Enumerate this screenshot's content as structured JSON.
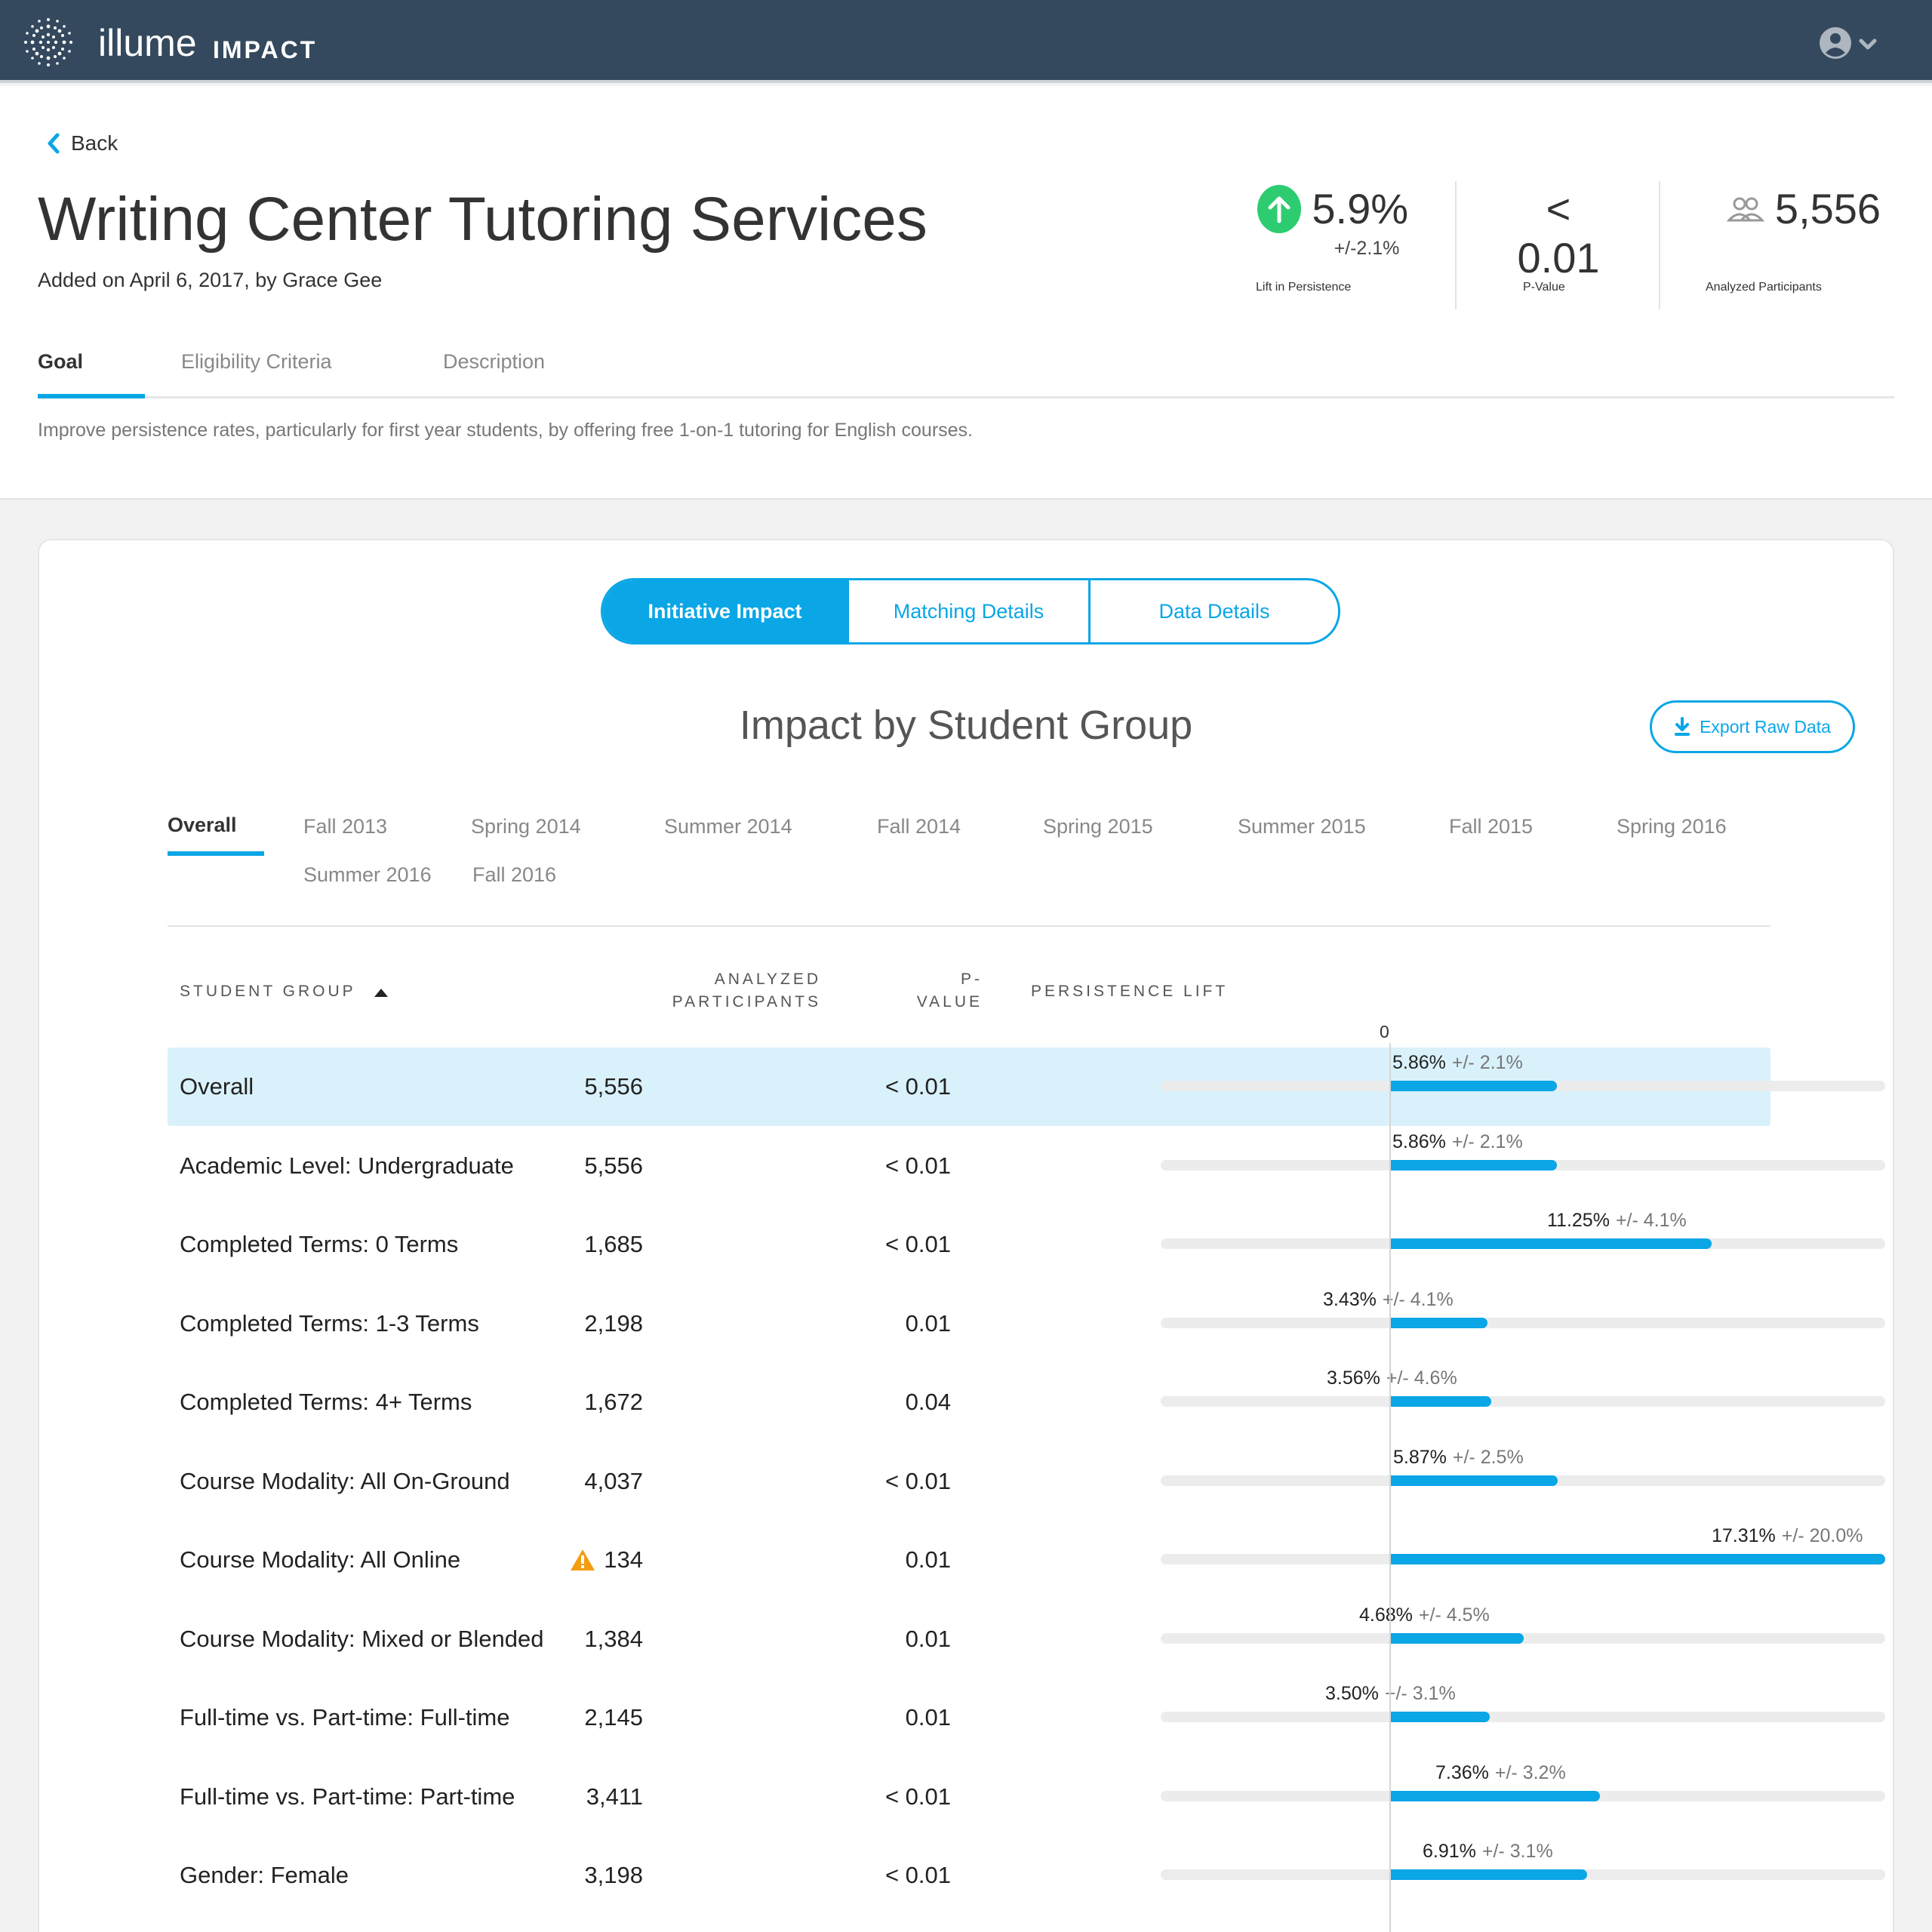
{
  "app": {
    "brand": "illume",
    "product": "IMPACT"
  },
  "nav": {
    "back_label": "Back"
  },
  "initiative": {
    "title": "Writing Center Tutoring Services",
    "added": "Added on April 6, 2017, by Grace Gee",
    "goal": "Improve persistence rates, particularly for first year students, by offering free 1-on-1 tutoring for English courses."
  },
  "stats": {
    "lift": {
      "value": "5.9%",
      "moe": "+/-2.1%",
      "label": "Lift in Persistence"
    },
    "pvalue": {
      "value": "< 0.01",
      "label": "P-Value"
    },
    "participants": {
      "value": "5,556",
      "label": "Analyzed Participants"
    }
  },
  "info_tabs": [
    "Goal",
    "Eligibility Criteria",
    "Description"
  ],
  "view_tabs": [
    "Initiative Impact",
    "Matching Details",
    "Data Details"
  ],
  "section": {
    "title": "Impact by Student Group",
    "export_label": "Export Raw Data"
  },
  "terms": [
    "Overall",
    "Fall 2013",
    "Spring 2014",
    "Summer 2014",
    "Fall 2014",
    "Spring 2015",
    "Summer 2015",
    "Fall 2015",
    "Spring 2016",
    "Summer 2016",
    "Fall 2016"
  ],
  "table": {
    "headers": {
      "group": "STUDENT GROUP",
      "analyzed_1": "ANALYZED",
      "analyzed_2": "PARTICIPANTS",
      "p_1": "P-",
      "p_2": "VALUE",
      "lift": "PERSISTENCE LIFT"
    },
    "zero_label": "0",
    "lift_max_pct": 17.31,
    "rows": [
      {
        "group": "Overall",
        "n": "5,556",
        "p": "< 0.01",
        "lift": 5.86,
        "lift_text": "5.86%",
        "moe": "+/- 2.1%",
        "warning": false
      },
      {
        "group": "Academic Level: Undergraduate",
        "n": "5,556",
        "p": "< 0.01",
        "lift": 5.86,
        "lift_text": "5.86%",
        "moe": "+/- 2.1%",
        "warning": false
      },
      {
        "group": "Completed Terms: 0 Terms",
        "n": "1,685",
        "p": "< 0.01",
        "lift": 11.25,
        "lift_text": "11.25%",
        "moe": "+/- 4.1%",
        "warning": false
      },
      {
        "group": "Completed Terms: 1-3 Terms",
        "n": "2,198",
        "p": "0.01",
        "lift": 3.43,
        "lift_text": "3.43%",
        "moe": "+/- 4.1%",
        "warning": false
      },
      {
        "group": "Completed Terms: 4+ Terms",
        "n": "1,672",
        "p": "0.04",
        "lift": 3.56,
        "lift_text": "3.56%",
        "moe": "+/- 4.6%",
        "warning": false
      },
      {
        "group": "Course Modality: All On-Ground",
        "n": "4,037",
        "p": "< 0.01",
        "lift": 5.87,
        "lift_text": "5.87%",
        "moe": "+/- 2.5%",
        "warning": false
      },
      {
        "group": "Course Modality: All Online",
        "n": "134",
        "p": "0.01",
        "lift": 17.31,
        "lift_text": "17.31%",
        "moe": "+/- 20.0%",
        "warning": true
      },
      {
        "group": "Course Modality: Mixed or Blended",
        "n": "1,384",
        "p": "0.01",
        "lift": 4.68,
        "lift_text": "4.68%",
        "moe": "+/- 4.5%",
        "warning": false
      },
      {
        "group": "Full-time vs. Part-time: Full-time",
        "n": "2,145",
        "p": "0.01",
        "lift": 3.5,
        "lift_text": "3.50%",
        "moe": "+/- 3.1%",
        "warning": false
      },
      {
        "group": "Full-time vs. Part-time: Part-time",
        "n": "3,411",
        "p": "< 0.01",
        "lift": 7.36,
        "lift_text": "7.36%",
        "moe": "+/- 3.2%",
        "warning": false
      },
      {
        "group": "Gender: Female",
        "n": "3,198",
        "p": "< 0.01",
        "lift": 6.91,
        "lift_text": "6.91%",
        "moe": "+/- 3.1%",
        "warning": false
      }
    ]
  },
  "colors": {
    "navbar": "#34495e",
    "accent": "#0aa6e6",
    "positive": "#2ecc71",
    "warning": "#f39c12",
    "highlight_row": "#d9f1fb"
  },
  "icons": {
    "logo": "sunburst-logo-icon",
    "user": "user-circle-icon",
    "back": "chevron-left-icon",
    "up": "arrow-up-icon",
    "people": "people-icon",
    "download": "download-icon",
    "sort": "sort-up-icon",
    "warning": "warning-icon"
  }
}
